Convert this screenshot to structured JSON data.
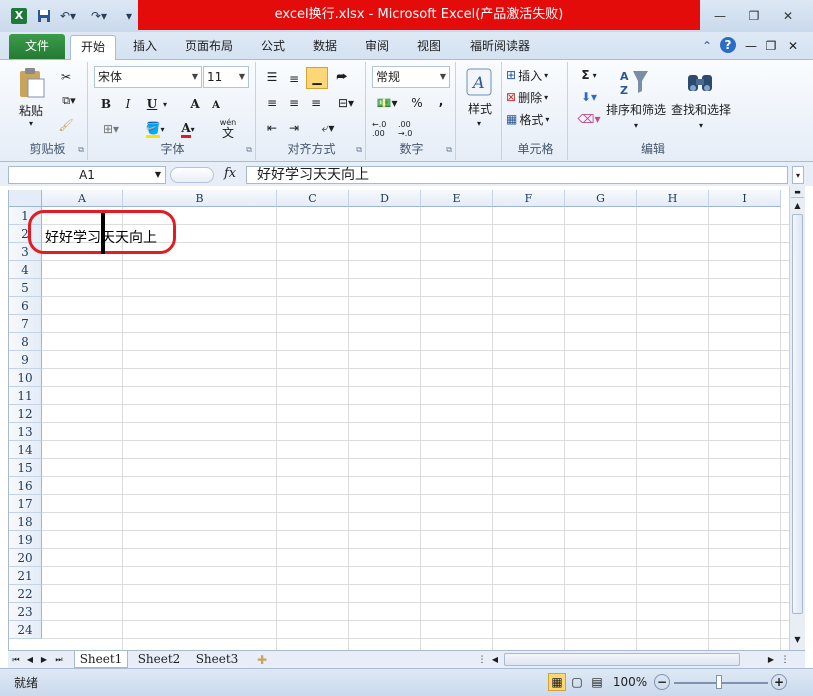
{
  "window": {
    "title": "excel换行.xlsx  -  Microsoft Excel(产品激活失败)",
    "minimize_icon": "minimize-icon",
    "restore_icon": "restore-icon",
    "close_icon": "close-icon"
  },
  "ribbon_tabs": {
    "file": "文件",
    "home": "开始",
    "insert": "插入",
    "page_layout": "页面布局",
    "formulas": "公式",
    "data": "数据",
    "review": "审阅",
    "view": "视图",
    "foxit": "福昕阅读器"
  },
  "clipboard": {
    "paste": "粘贴",
    "label": "剪贴板"
  },
  "font": {
    "name": "宋体",
    "size": "11",
    "bold": "B",
    "italic": "I",
    "underline": "U",
    "grow": "A",
    "shrink": "A",
    "font_color_letter": "A",
    "wen": "wén",
    "wen_char": "文",
    "label": "字体"
  },
  "alignment": {
    "label": "对齐方式"
  },
  "number": {
    "format": "常规",
    "percent": "%",
    "comma": ",",
    "inc_decimal": "←.0 .00",
    "dec_decimal": ".00 →.0",
    "label": "数字"
  },
  "styles": {
    "label": "样式"
  },
  "cells": {
    "insert": "插入",
    "delete": "删除",
    "format": "格式",
    "label": "单元格"
  },
  "editing": {
    "sum": "Σ",
    "sort_filter": "排序和筛选",
    "find_select": "查找和选择",
    "label": "编辑"
  },
  "formula_bar": {
    "name_box": "A1",
    "fx": "fx",
    "content": "好好学习天天向上"
  },
  "grid": {
    "columns": [
      "A",
      "B",
      "C",
      "D",
      "E",
      "F",
      "G",
      "H",
      "I"
    ],
    "rows": [
      "1",
      "2",
      "3",
      "4",
      "5",
      "6",
      "7",
      "8",
      "9",
      "10",
      "11",
      "12",
      "13",
      "14",
      "15",
      "16",
      "17",
      "18",
      "19",
      "20",
      "21",
      "22",
      "23",
      "24"
    ],
    "a1": "好好学习天天向上"
  },
  "sheets": [
    "Sheet1",
    "Sheet2",
    "Sheet3"
  ],
  "status": {
    "mode": "就绪",
    "zoom": "100%"
  },
  "colors": {
    "annotation": "#e31b23",
    "title_highlight": "#e40b0b",
    "file_tab": "#2a8a3c"
  }
}
